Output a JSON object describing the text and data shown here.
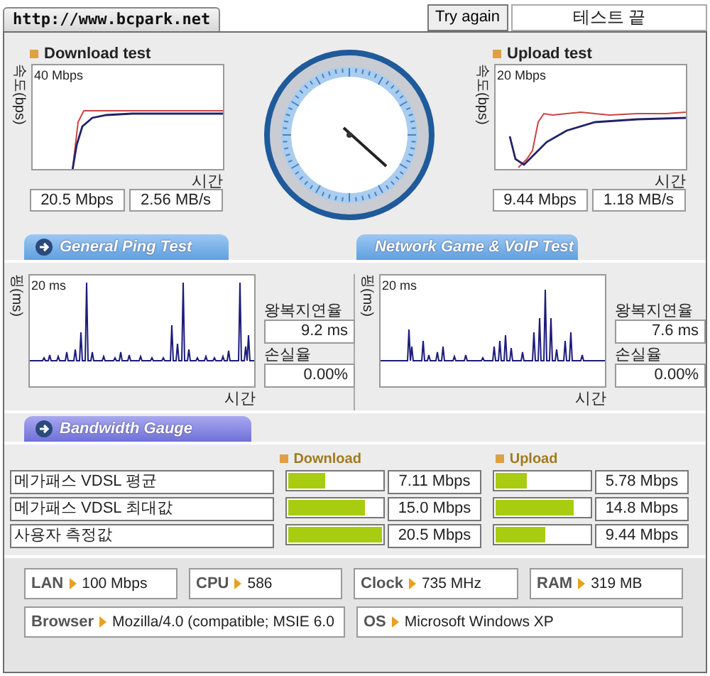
{
  "header": {
    "url": "http://www.bcpark.net",
    "retry_button": "Try again",
    "status": "테스트 끝"
  },
  "speed": [
    {
      "kind": "download",
      "title": "Download test",
      "y_label": "속도(bps)",
      "scale": "40 Mbps",
      "x_label": "시간",
      "readings": [
        "20.5 Mbps",
        "2.56 MB/s"
      ]
    },
    {
      "kind": "upload",
      "title": "Upload test",
      "y_label": "속도(bps)",
      "scale": "20 Mbps",
      "x_label": "시간",
      "readings": [
        "9.44 Mbps",
        "1.18 MB/s"
      ]
    }
  ],
  "ping_tests": [
    {
      "kind": "ping",
      "title": "General Ping Test",
      "y_label": "핑(ms)",
      "scale": "20 ms",
      "x_label": "시간",
      "latency_label": "왕복지연율",
      "latency": "9.2 ms",
      "loss_label": "손실율",
      "loss": "0.00%"
    },
    {
      "kind": "game",
      "title": "Network Game & VoIP Test",
      "y_label": "핑(ms)",
      "scale": "20 ms",
      "x_label": "시간",
      "latency_label": "왕복지연율",
      "latency": "7.6 ms",
      "loss_label": "손실율",
      "loss": "0.00%"
    }
  ],
  "bandwidth": {
    "title": "Bandwidth Gauge",
    "columns": [
      "Download",
      "Upload"
    ],
    "rows": [
      {
        "label": "메가패스 VDSL 평균",
        "download": {
          "level": 0.4,
          "reading": "7.11 Mbps"
        },
        "upload": {
          "level": 0.33,
          "reading": "5.78 Mbps"
        }
      },
      {
        "label": "메가패스 VDSL 최대값",
        "download": {
          "level": 0.82,
          "reading": "15.0 Mbps"
        },
        "upload": {
          "level": 0.83,
          "reading": "14.8 Mbps"
        }
      },
      {
        "label": "사용자 측정값",
        "download": {
          "level": 1.0,
          "reading": "20.5 Mbps"
        },
        "upload": {
          "level": 0.53,
          "reading": "9.44 Mbps"
        }
      }
    ]
  },
  "system": [
    {
      "label": "LAN",
      "value": "100 Mbps"
    },
    {
      "label": "CPU",
      "value": "586"
    },
    {
      "label": "Clock",
      "value": "735 MHz"
    },
    {
      "label": "RAM",
      "value": "319 MB"
    },
    {
      "label": "Browser",
      "value": "Mozilla/4.0 (compatible; MSIE 6.0"
    },
    {
      "label": "OS",
      "value": "Microsoft Windows XP"
    }
  ]
}
